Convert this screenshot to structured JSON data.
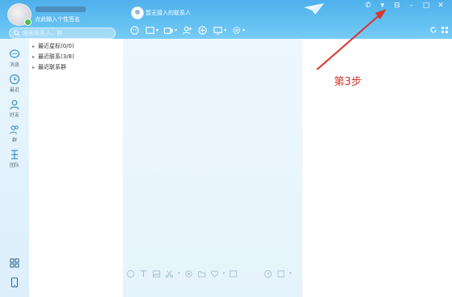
{
  "profile": {
    "signature": "点此输入个性签名"
  },
  "search": {
    "placeholder": "搜索联系人、群"
  },
  "chat": {
    "title": "暂无接入的联系人"
  },
  "sidebar": {
    "items": [
      {
        "icon": "message-icon",
        "label": "消息"
      },
      {
        "icon": "clock-icon",
        "label": "最近"
      },
      {
        "icon": "friend-icon",
        "label": "好友"
      },
      {
        "icon": "group-icon",
        "label": "群"
      },
      {
        "icon": "team-icon",
        "label": "团队"
      }
    ]
  },
  "contacts": {
    "groups": [
      {
        "label": "最近星标(0/0)"
      },
      {
        "label": "最近联系(3/8)"
      },
      {
        "label": "最近联系群"
      }
    ]
  },
  "annotation": {
    "text": "第3步",
    "color": "#d9342b"
  },
  "colors": {
    "titlebar": "#5ab8ef",
    "sidebar": "#e5f3fc",
    "accent": "#d9342b"
  }
}
